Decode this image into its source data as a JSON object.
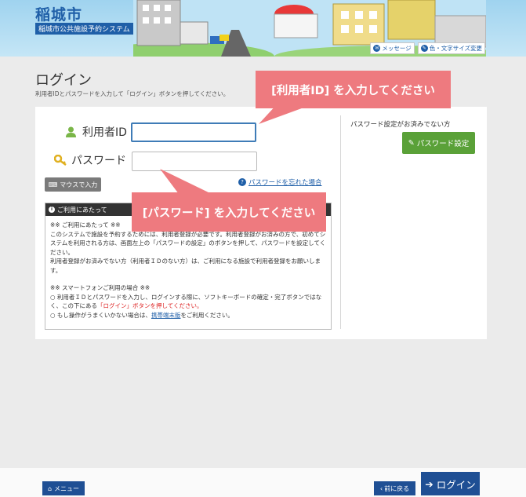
{
  "header": {
    "city_name": "稲城市",
    "system_name": "稲城市公共施設予約システム",
    "links": [
      {
        "label": "メッセージ",
        "icon": "message-icon"
      },
      {
        "label": "色・文字サイズ変更",
        "icon": "pencil-icon"
      }
    ]
  },
  "page": {
    "title": "ログイン",
    "description": "利用者IDとパスワードを入力して「ログイン」ボタンを押してください。"
  },
  "form": {
    "user_id_label": "利用者ID",
    "user_id_value": "",
    "password_label": "パスワード",
    "password_value": "",
    "mouse_input_label": "マウスで入力",
    "forgot_password_label": "パスワードを忘れた場合"
  },
  "notice": {
    "heading": "ご利用にあたって",
    "line1": "※※ ご利用にあたって ※※",
    "line2": "このシステムで施設を予約するためには、利用者登録が必要です。利用者登録がお済みの方で、初めてシステムを利用される方は、画面左上の「パスワードの設定」のボタンを押して、パスワードを設定してください。",
    "line3": "利用者登録がお済みでない方（利用者ＩＤのない方）は、ご利用になる施設で利用者登録をお願いします。",
    "line4": "※※ スマートフォンご利用の場合 ※※",
    "line5a": "○ 利用者ＩＤとパスワードを入力し、ログインする際に、ソフトキーボードの確定・完了ボタンではなく、この下にある",
    "line5b": "「ログイン」ボタンを押してください。",
    "line6a": "○ もし操作がうまくいかない場合は、",
    "line6b": "携帯端末版",
    "line6c": "をご利用ください。"
  },
  "right": {
    "title": "パスワード設定がお済みでない方",
    "button_label": "パスワード設定"
  },
  "callouts": {
    "user_id_hint": "[利用者ID] を入力してください",
    "password_hint": "[パスワード] を入力してください"
  },
  "footer": {
    "menu_label": "メニュー",
    "back_label": "前に戻る",
    "login_label": "ログイン"
  },
  "colors": {
    "brand": "#1f4f94",
    "green": "#5aa138",
    "callout": "#ee7a7f"
  }
}
